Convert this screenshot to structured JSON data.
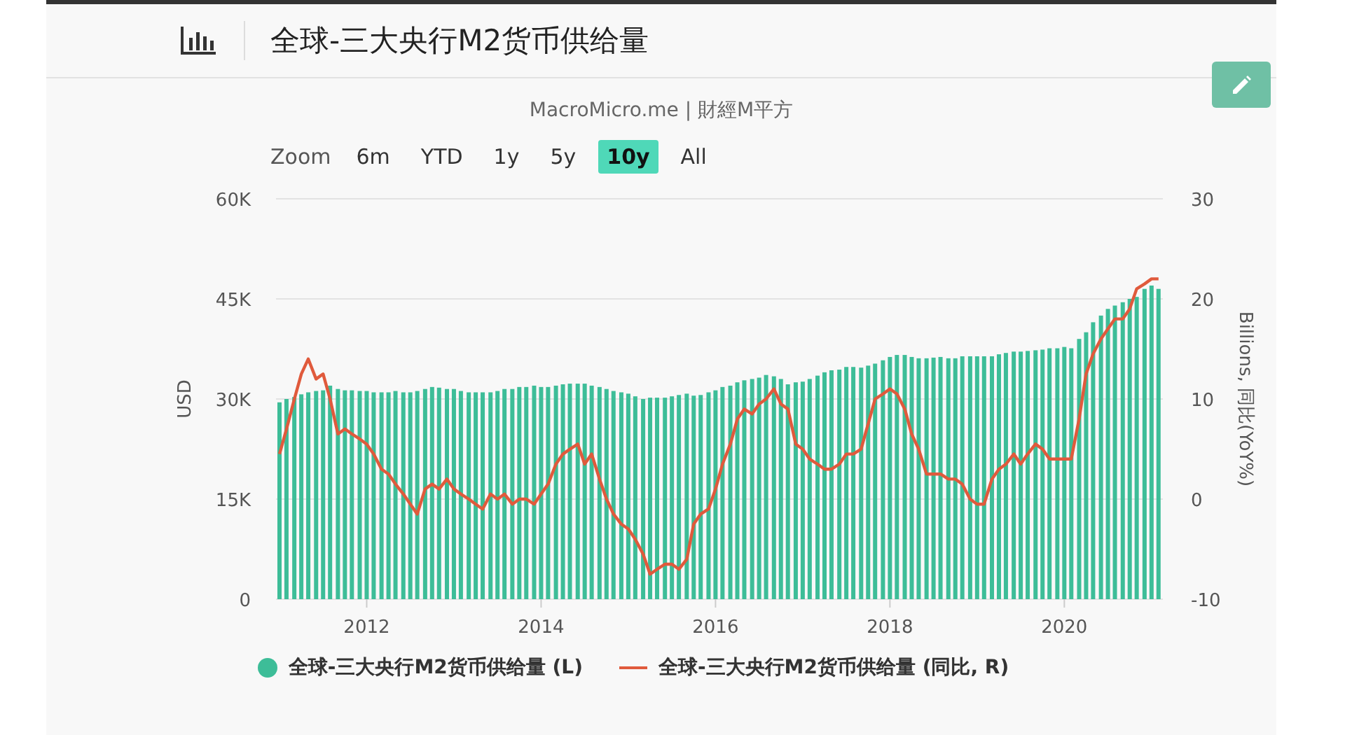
{
  "header": {
    "title": "全球-三大央行M2货币供给量"
  },
  "credits": "MacroMicro.me | 財經M平方",
  "zoom": {
    "label": "Zoom",
    "options": [
      {
        "label": "6m",
        "selected": false
      },
      {
        "label": "YTD",
        "selected": false
      },
      {
        "label": "1y",
        "selected": false
      },
      {
        "label": "5y",
        "selected": false
      },
      {
        "label": "10y",
        "selected": true
      },
      {
        "label": "All",
        "selected": false
      }
    ]
  },
  "charts": [
    {
      "chart_data": {
        "type": "bar",
        "ylabel": "USD",
        "grid": true,
        "xlim": [
          2010.96,
          2021.13
        ],
        "xticks": [
          2012,
          2014,
          2016,
          2018,
          2020
        ],
        "ylim": [
          0,
          60000
        ],
        "yticks": [
          {
            "value": 0,
            "label": "0"
          },
          {
            "value": 15000,
            "label": "15K"
          },
          {
            "value": 30000,
            "label": "30K"
          },
          {
            "value": 45000,
            "label": "45K"
          },
          {
            "value": 60000,
            "label": "60K"
          }
        ],
        "x": [
          2011,
          2011.08,
          2011.17,
          2011.25,
          2011.33,
          2011.42,
          2011.5,
          2011.58,
          2011.67,
          2011.75,
          2011.83,
          2011.92,
          2012,
          2012.08,
          2012.17,
          2012.25,
          2012.33,
          2012.42,
          2012.5,
          2012.58,
          2012.67,
          2012.75,
          2012.83,
          2012.92,
          2013,
          2013.08,
          2013.17,
          2013.25,
          2013.33,
          2013.42,
          2013.5,
          2013.58,
          2013.67,
          2013.75,
          2013.83,
          2013.92,
          2014,
          2014.08,
          2014.17,
          2014.25,
          2014.33,
          2014.42,
          2014.5,
          2014.58,
          2014.67,
          2014.75,
          2014.83,
          2014.92,
          2015,
          2015.08,
          2015.17,
          2015.25,
          2015.33,
          2015.42,
          2015.5,
          2015.58,
          2015.67,
          2015.75,
          2015.83,
          2015.92,
          2016,
          2016.08,
          2016.17,
          2016.25,
          2016.33,
          2016.42,
          2016.5,
          2016.58,
          2016.67,
          2016.75,
          2016.83,
          2016.92,
          2017,
          2017.08,
          2017.17,
          2017.25,
          2017.33,
          2017.42,
          2017.5,
          2017.58,
          2017.67,
          2017.75,
          2017.83,
          2017.92,
          2018,
          2018.08,
          2018.17,
          2018.25,
          2018.33,
          2018.42,
          2018.5,
          2018.58,
          2018.67,
          2018.75,
          2018.83,
          2018.92,
          2019,
          2019.08,
          2019.17,
          2019.25,
          2019.33,
          2019.42,
          2019.5,
          2019.58,
          2019.67,
          2019.75,
          2019.83,
          2019.92,
          2020,
          2020.08,
          2020.17,
          2020.25,
          2020.33,
          2020.42,
          2020.5,
          2020.58,
          2020.67,
          2020.75,
          2020.83,
          2020.92,
          2021,
          2021.08
        ],
        "series": [
          {
            "name": "全球-三大央行M2货币供给量 (L)",
            "color": "#3dbd98",
            "values": [
              29500,
              30000,
              30300,
              30700,
              31000,
              31200,
              31300,
              32000,
              31500,
              31300,
              31300,
              31200,
              31200,
              31000,
              31000,
              31000,
              31200,
              31000,
              31000,
              31200,
              31500,
              31800,
              31700,
              31500,
              31500,
              31200,
              31000,
              31000,
              31000,
              31000,
              31200,
              31500,
              31500,
              31800,
              31800,
              32000,
              31800,
              31800,
              32000,
              32200,
              32300,
              32300,
              32300,
              32000,
              31800,
              31500,
              31200,
              31000,
              30800,
              30400,
              30000,
              30200,
              30200,
              30200,
              30400,
              30600,
              30800,
              30500,
              30600,
              31000,
              31300,
              31800,
              32000,
              32500,
              32800,
              33000,
              33200,
              33600,
              33400,
              33000,
              32200,
              32500,
              32600,
              33000,
              33500,
              34000,
              34300,
              34400,
              34800,
              34800,
              34700,
              35000,
              35300,
              35800,
              36300,
              36600,
              36600,
              36300,
              36100,
              36100,
              36200,
              36300,
              36100,
              36100,
              36400,
              36400,
              36400,
              36400,
              36400,
              36700,
              36900,
              37100,
              37100,
              37200,
              37300,
              37400,
              37600,
              37600,
              37800,
              37600,
              39000,
              40000,
              41500,
              42500,
              43500,
              44000,
              44500,
              45000,
              45300,
              46500,
              47000,
              46500
            ]
          }
        ]
      }
    },
    {
      "chart_data": {
        "type": "line",
        "ylabel": "Billions, 同比(YoY%)",
        "xlim": [
          2010.96,
          2021.13
        ],
        "ylim": [
          -10,
          30
        ],
        "yticks": [
          -10,
          0,
          10,
          20,
          30
        ],
        "x": [
          2011,
          2011.08,
          2011.17,
          2011.25,
          2011.33,
          2011.42,
          2011.5,
          2011.58,
          2011.67,
          2011.75,
          2011.83,
          2011.92,
          2012,
          2012.08,
          2012.17,
          2012.25,
          2012.33,
          2012.42,
          2012.5,
          2012.58,
          2012.67,
          2012.75,
          2012.83,
          2012.92,
          2013,
          2013.08,
          2013.17,
          2013.25,
          2013.33,
          2013.42,
          2013.5,
          2013.58,
          2013.67,
          2013.75,
          2013.83,
          2013.92,
          2014,
          2014.08,
          2014.17,
          2014.25,
          2014.33,
          2014.42,
          2014.5,
          2014.58,
          2014.67,
          2014.75,
          2014.83,
          2014.92,
          2015,
          2015.08,
          2015.17,
          2015.25,
          2015.33,
          2015.42,
          2015.5,
          2015.58,
          2015.67,
          2015.75,
          2015.83,
          2015.92,
          2016,
          2016.08,
          2016.17,
          2016.25,
          2016.33,
          2016.42,
          2016.5,
          2016.58,
          2016.67,
          2016.75,
          2016.83,
          2016.92,
          2017,
          2017.08,
          2017.17,
          2017.25,
          2017.33,
          2017.42,
          2017.5,
          2017.58,
          2017.67,
          2017.75,
          2017.83,
          2017.92,
          2018,
          2018.08,
          2018.17,
          2018.25,
          2018.33,
          2018.42,
          2018.5,
          2018.58,
          2018.67,
          2018.75,
          2018.83,
          2018.92,
          2019,
          2019.08,
          2019.17,
          2019.25,
          2019.33,
          2019.42,
          2019.5,
          2019.58,
          2019.67,
          2019.75,
          2019.83,
          2019.92,
          2020,
          2020.08,
          2020.17,
          2020.25,
          2020.33,
          2020.42,
          2020.5,
          2020.58,
          2020.67,
          2020.75,
          2020.83,
          2020.92,
          2021,
          2021.08
        ],
        "series": [
          {
            "name": "全球-三大央行M2货币供给量 (同比, R)",
            "color": "#e05a3c",
            "values": [
              4.5,
              7,
              10,
              12.5,
              14,
              12,
              12.5,
              10,
              6.5,
              7,
              6.5,
              6,
              5.5,
              4.5,
              3,
              2.5,
              1.5,
              0.5,
              -0.5,
              -1.5,
              1,
              1.5,
              1,
              2,
              1,
              0.5,
              0,
              -0.5,
              -1,
              0.5,
              0,
              0.5,
              -0.5,
              0,
              0,
              -0.5,
              0.5,
              1.5,
              3.5,
              4.5,
              5,
              5.5,
              3.5,
              4.5,
              2,
              0,
              -1.5,
              -2.5,
              -3,
              -4,
              -5.5,
              -7.5,
              -7,
              -6.5,
              -6.5,
              -7,
              -6,
              -2.5,
              -1.5,
              -1,
              1,
              3.5,
              5.5,
              8,
              9,
              8.5,
              9.5,
              10,
              11,
              9.5,
              9,
              5.5,
              5,
              4,
              3.5,
              3,
              3,
              3.5,
              4.5,
              4.5,
              5,
              7.5,
              10,
              10.5,
              11,
              10.5,
              9,
              6.5,
              5,
              2.5,
              2.5,
              2.5,
              2,
              2,
              1.5,
              0,
              -0.5,
              -0.5,
              2,
              3,
              3.5,
              4.5,
              3.5,
              4.5,
              5.5,
              5,
              4,
              4,
              4,
              4,
              8,
              12.5,
              14.5,
              16,
              17,
              18,
              18,
              19,
              21,
              21.5,
              22,
              22
            ]
          }
        ]
      }
    }
  ]
}
